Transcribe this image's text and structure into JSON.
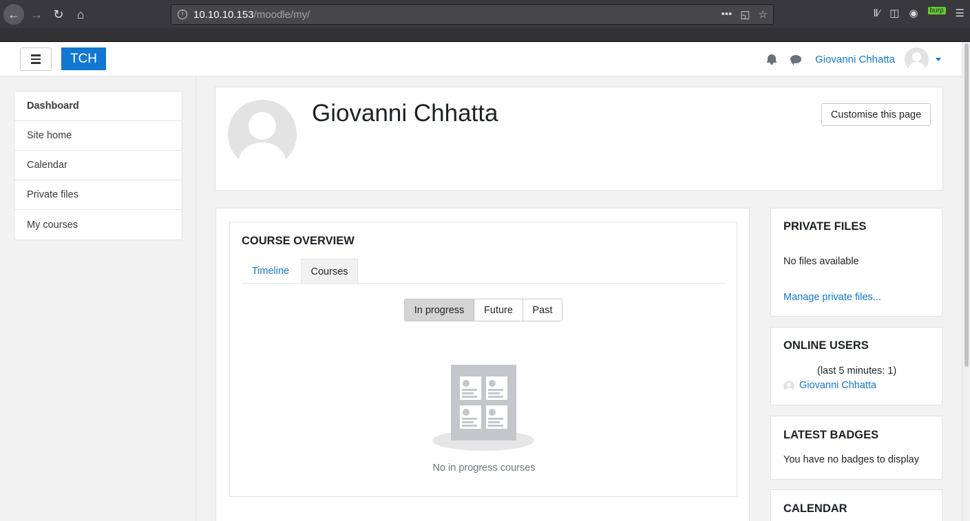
{
  "browser": {
    "url_host": "10.10.10.153",
    "url_path": "/moodle/my/",
    "burp_label": "burp",
    "icons": [
      "back-icon",
      "forward-icon",
      "reload-icon",
      "home-icon",
      "info-icon",
      "more-icon",
      "pocket-icon",
      "bookmark-star-icon",
      "library-icon",
      "sidebar-icon",
      "account-icon",
      "burp-extension-icon",
      "menu-icon"
    ]
  },
  "header": {
    "brand": "TCH",
    "user_name": "Giovanni Chhatta",
    "accent_color": "#1177d1"
  },
  "nav": {
    "items": [
      {
        "label": "Dashboard"
      },
      {
        "label": "Site home"
      },
      {
        "label": "Calendar"
      },
      {
        "label": "Private files"
      },
      {
        "label": "My courses"
      }
    ]
  },
  "page": {
    "title": "Giovanni Chhatta",
    "customise_label": "Customise this page"
  },
  "course_overview": {
    "title": "COURSE OVERVIEW",
    "tabs": [
      {
        "label": "Timeline"
      },
      {
        "label": "Courses"
      }
    ],
    "filters": [
      {
        "label": "In progress"
      },
      {
        "label": "Future"
      },
      {
        "label": "Past"
      }
    ],
    "selected_filter": "In progress",
    "empty_text": "No in progress courses"
  },
  "blocks": {
    "private_files": {
      "title": "PRIVATE FILES",
      "text": "No files available",
      "link": "Manage private files..."
    },
    "online_users": {
      "title": "ONLINE USERS",
      "info": "(last 5 minutes: 1)",
      "user": "Giovanni Chhatta"
    },
    "latest_badges": {
      "title": "LATEST BADGES",
      "text": "You have no badges to display"
    },
    "calendar": {
      "title": "CALENDAR"
    }
  }
}
